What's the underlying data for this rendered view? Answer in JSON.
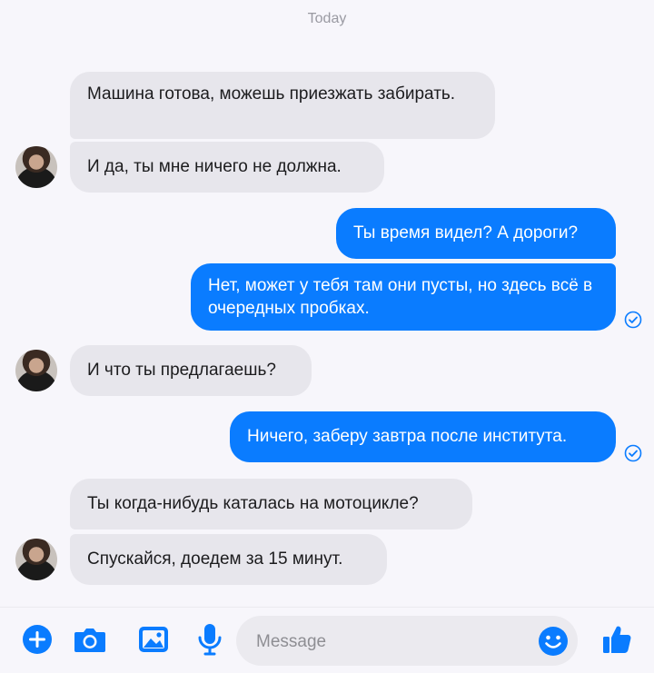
{
  "thread": {
    "date_label": "Today",
    "messages": [
      {
        "side": "in",
        "text": "Машина готова, можешь приезжать забирать."
      },
      {
        "side": "in",
        "text": "И да, ты мне ничего не должна."
      },
      {
        "side": "out",
        "text": "Ты время видел? А дороги?"
      },
      {
        "side": "out",
        "text": "Нет, может у тебя там они пусты, но здесь всё в очередных пробках."
      },
      {
        "side": "in",
        "text": "И что ты предлагаешь?"
      },
      {
        "side": "out",
        "text": "Ничего, заберу завтра после института."
      },
      {
        "side": "in",
        "text": "Ты когда-нибудь каталась на мотоцикле?"
      },
      {
        "side": "in",
        "text": "Спускайся, доедем за 15 минут."
      }
    ]
  },
  "composer": {
    "placeholder": "Message",
    "icons": [
      "plus-icon",
      "camera-icon",
      "image-icon",
      "microphone-icon",
      "emoji-icon",
      "thumbs-up-icon"
    ]
  },
  "colors": {
    "accent": "#0a7cff",
    "incoming_bubble": "#e7e6ec",
    "background": "#f7f6fb"
  }
}
